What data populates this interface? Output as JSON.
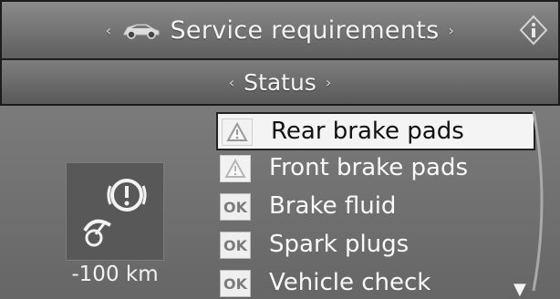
{
  "header": {
    "title": "Service requirements",
    "left_arrow": "‹",
    "right_arrow": "›",
    "car_icon": "car-icon",
    "info_icon": "info-icon"
  },
  "subheader": {
    "title": "Status",
    "left_arrow": "‹",
    "right_arrow": "›"
  },
  "left_panel": {
    "icon": "brake-warning-icon",
    "distance": "-100 km"
  },
  "items": [
    {
      "label": "Rear brake pads",
      "status": "warning",
      "selected": true
    },
    {
      "label": "Front brake pads",
      "status": "warning",
      "selected": false
    },
    {
      "label": "Brake fluid",
      "status": "ok",
      "badge": "OK",
      "selected": false
    },
    {
      "label": "Spark plugs",
      "status": "ok",
      "badge": "OK",
      "selected": false
    },
    {
      "label": "Vehicle check",
      "status": "ok",
      "badge": "OK",
      "selected": false
    }
  ],
  "scroll": {
    "down_indicator": "▼"
  },
  "colors": {
    "background": "#6f6f6f",
    "selection": "#f4f4f4",
    "text": "#fafafa"
  }
}
